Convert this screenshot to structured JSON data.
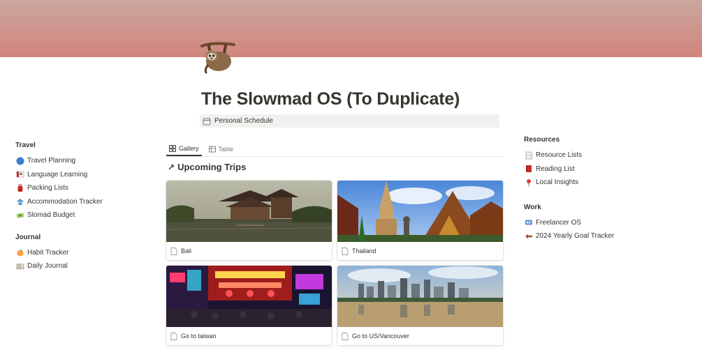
{
  "page": {
    "title": "The Slowmad OS (To Duplicate)",
    "icon": "sloth-icon",
    "property": {
      "icon": "calendar-icon",
      "label": "Personal Schedule"
    }
  },
  "left": {
    "sections": [
      {
        "title": "Travel",
        "items": [
          {
            "icon": "globe-icon",
            "label": "Travel Planning"
          },
          {
            "icon": "flag-icon",
            "label": "Language Learning"
          },
          {
            "icon": "backpack-icon",
            "label": "Packing Lists"
          },
          {
            "icon": "hut-icon",
            "label": "Accommodation Tracker"
          },
          {
            "icon": "money-icon",
            "label": "Slomad Budget"
          }
        ]
      },
      {
        "title": "Journal",
        "items": [
          {
            "icon": "peach-icon",
            "label": "Habit Tracker"
          },
          {
            "icon": "book-icon",
            "label": "Daily Journal"
          }
        ]
      }
    ]
  },
  "right": {
    "sections": [
      {
        "title": "Resources",
        "items": [
          {
            "icon": "page-icon",
            "label": "Resource Lists"
          },
          {
            "icon": "red-book-icon",
            "label": "Reading List"
          },
          {
            "icon": "pin-icon",
            "label": "Local Insights"
          }
        ]
      },
      {
        "title": "Work",
        "items": [
          {
            "icon": "id-card-icon",
            "label": "Freelancer OS"
          },
          {
            "icon": "back-arrow-icon",
            "label": "2024 Yearly Goal Tracker"
          }
        ]
      }
    ]
  },
  "gallery": {
    "tabs": [
      {
        "icon": "grid-icon",
        "label": "Gallery",
        "active": true
      },
      {
        "icon": "table-icon",
        "label": "Table",
        "active": false
      }
    ],
    "title": "Upcoming Trips",
    "cards": [
      {
        "label": "Bali",
        "image": "bali-temple"
      },
      {
        "label": "Thailand",
        "image": "thai-temple"
      },
      {
        "label": "Go to taiwan",
        "image": "taiwan-night-market"
      },
      {
        "label": "Go to US/Vancouver",
        "image": "vancouver-skyline"
      }
    ]
  },
  "colors": {
    "cover_top": "#c9a8a0",
    "cover_bottom": "#d0857d",
    "text": "#37352f",
    "muted": "#787774"
  }
}
